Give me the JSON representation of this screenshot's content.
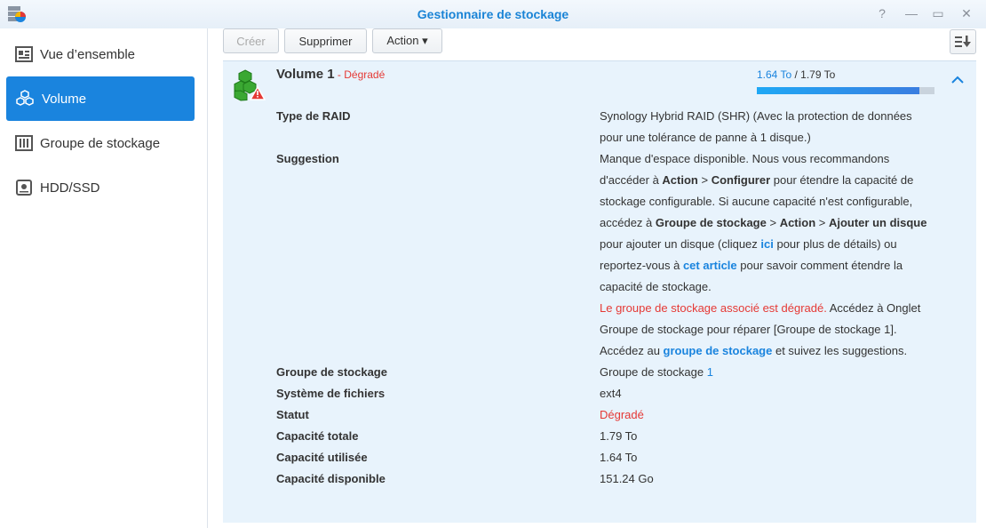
{
  "window": {
    "title": "Gestionnaire de stockage",
    "controls": [
      "?",
      "—",
      "▭",
      "✕"
    ]
  },
  "sidebar": {
    "items": [
      {
        "label": "Vue d’ensemble",
        "icon": "overview-icon"
      },
      {
        "label": "Volume",
        "icon": "volume-icon",
        "active": true
      },
      {
        "label": "Groupe de stockage",
        "icon": "storage-pool-icon"
      },
      {
        "label": "HDD/SSD",
        "icon": "hdd-icon"
      }
    ]
  },
  "toolbar": {
    "create": "Créer",
    "delete": "Supprimer",
    "action": "Action ▾",
    "sort_icon": "sort-icon"
  },
  "volume": {
    "name": "Volume 1",
    "status": " - Dégradé",
    "used": "1.64 To",
    "sep": " / ",
    "total": "1.79 To",
    "usage_percent": 91.6,
    "rows": [
      {
        "label": "Type de RAID",
        "paras": [
          [
            {
              "t": "Synology Hybrid RAID (SHR) (Avec la protection de données pour une tolérance de panne à 1 disque.)"
            }
          ]
        ]
      },
      {
        "label": "Suggestion",
        "paras": [
          [
            {
              "t": "Manque d'espace disponible. Nous vous recommandons d'accéder à "
            },
            {
              "t": "Action",
              "s": "b"
            },
            {
              "t": " > "
            },
            {
              "t": "Configurer",
              "s": "b"
            },
            {
              "t": " pour étendre la capacité de stockage configurable. Si aucune capacité n'est configurable, accédez à "
            },
            {
              "t": "Groupe de stockage",
              "s": "b"
            },
            {
              "t": " > "
            },
            {
              "t": "Action",
              "s": "b"
            },
            {
              "t": " > "
            },
            {
              "t": "Ajouter un disque",
              "s": "b"
            },
            {
              "t": " pour ajouter un disque (cliquez "
            },
            {
              "t": "ici",
              "s": "lnk"
            },
            {
              "t": " pour plus de détails) ou reportez-vous à "
            },
            {
              "t": "cet article",
              "s": "lnk"
            },
            {
              "t": " pour savoir comment étendre la capacité de stockage."
            }
          ],
          [
            {
              "t": "Le groupe de stockage associé est dégradé.",
              "s": "red"
            },
            {
              "t": " Accédez à Onglet Groupe de stockage pour réparer [Groupe de stockage 1]."
            }
          ],
          [
            {
              "t": "Accédez au "
            },
            {
              "t": "groupe de stockage",
              "s": "lnk"
            },
            {
              "t": " et suivez les suggestions."
            }
          ]
        ]
      },
      {
        "label": "Groupe de stockage",
        "paras": [
          [
            {
              "t": "Groupe de stockage "
            },
            {
              "t": "1",
              "s": "blue"
            }
          ]
        ]
      },
      {
        "label": "Système de fichiers",
        "paras": [
          [
            {
              "t": "ext4"
            }
          ]
        ]
      },
      {
        "label": "Statut",
        "paras": [
          [
            {
              "t": "Dégradé",
              "s": "red"
            }
          ]
        ]
      },
      {
        "label": "Capacité totale",
        "paras": [
          [
            {
              "t": "1.79 To"
            }
          ]
        ]
      },
      {
        "label": "Capacité utilisée",
        "paras": [
          [
            {
              "t": "1.64 To"
            }
          ]
        ]
      },
      {
        "label": "Capacité disponible",
        "paras": [
          [
            {
              "t": "151.24 Go"
            }
          ]
        ]
      }
    ]
  }
}
